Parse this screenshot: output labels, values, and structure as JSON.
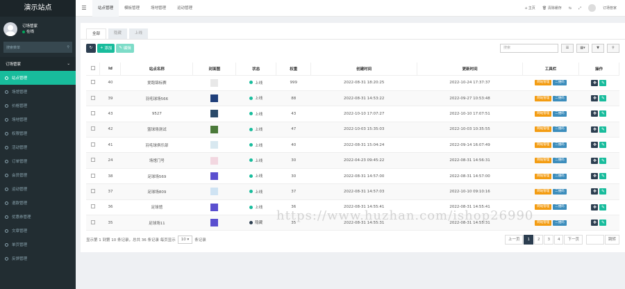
{
  "app": {
    "title": "演示站点",
    "user_name": "订场管家",
    "user_status": "在线",
    "search_placeholder": "搜索菜单"
  },
  "sidebar": {
    "group": "订场管家",
    "items": [
      {
        "label": "站点管理",
        "active": true
      },
      {
        "label": "场馆管理"
      },
      {
        "label": "价格管理"
      },
      {
        "label": "场地管理"
      },
      {
        "label": "权限管理"
      },
      {
        "label": "活动管理"
      },
      {
        "label": "订单管理"
      },
      {
        "label": "会员管理"
      },
      {
        "label": "运动管理"
      },
      {
        "label": "退款管理"
      },
      {
        "label": "优惠券管理"
      },
      {
        "label": "文章管理"
      },
      {
        "label": "单页管理"
      },
      {
        "label": "反馈管理"
      }
    ]
  },
  "topbar": {
    "tabs": [
      "站点管理",
      "模板管理",
      "场地管理",
      "运动管理"
    ],
    "home": "主页",
    "clear_cache": "清除缓存",
    "user": "订场管家"
  },
  "subtabs": [
    "全部",
    "隐藏",
    "上线"
  ],
  "toolbar": {
    "add": "添加",
    "edit": "编辑",
    "search_placeholder": "搜索"
  },
  "table": {
    "headers": [
      "Id",
      "站点名称",
      "封面图",
      "状态",
      "权重",
      "创建时间",
      "更新时间",
      "工具栏",
      "操作"
    ],
    "rows": [
      {
        "id": "40",
        "name": "爱跑锦标赛",
        "status": "上线",
        "weight": "999",
        "created": "2022-08-31 18:20:25",
        "updated": "2022-10-24 17:37:37"
      },
      {
        "id": "39",
        "name": "羽毛球场566",
        "status": "上线",
        "weight": "88",
        "created": "2022-08-31 14:53:22",
        "updated": "2022-09-27 10:53:48"
      },
      {
        "id": "43",
        "name": "9527",
        "status": "上线",
        "weight": "43",
        "created": "2022-10-10 17:07:27",
        "updated": "2022-10-10 17:07:51"
      },
      {
        "id": "42",
        "name": "篮球场测试",
        "status": "上线",
        "weight": "47",
        "created": "2022-10-03 15:35:03",
        "updated": "2022-10-03 10:35:55"
      },
      {
        "id": "41",
        "name": "羽毛球俱乐部",
        "status": "上线",
        "weight": "40",
        "created": "2022-08-31 15:04:24",
        "updated": "2022-09-14 16:07:49"
      },
      {
        "id": "24",
        "name": "场馆门号",
        "status": "上线",
        "weight": "30",
        "created": "2022-04-23 09:45:22",
        "updated": "2022-08-31 14:56:31"
      },
      {
        "id": "38",
        "name": "足球场569",
        "status": "上线",
        "weight": "30",
        "created": "2022-08-31 14:57:00",
        "updated": "2022-08-31 14:57:00"
      },
      {
        "id": "37",
        "name": "足球场809",
        "status": "上线",
        "weight": "37",
        "created": "2022-08-31 14:57:03",
        "updated": "2022-10-10 09:10:16"
      },
      {
        "id": "36",
        "name": "足球馆",
        "status": "上线",
        "weight": "36",
        "created": "2022-08-31 14:55:41",
        "updated": "2022-08-31 14:55:41"
      },
      {
        "id": "35",
        "name": "足球场11",
        "status": "隐藏",
        "weight": "35",
        "created": "2022-08-31 14:55:31",
        "updated": "2022-08-31 14:55:31"
      }
    ],
    "tool1": "网站管理",
    "tool2": "二维码"
  },
  "footer": {
    "summary": "显示第 1 到第 10 条记录，总共 36 条记录 每页显示",
    "per_page": "10",
    "suffix": "条记录",
    "pages": [
      "上一页",
      "1",
      "2",
      "3",
      "4",
      "下一页"
    ],
    "goto": "跳转"
  },
  "colors": {
    "accent": "#18bc9c",
    "sidebar": "#222d32",
    "online": "#18bc9c",
    "hidden": "#2c3e50"
  },
  "watermark": "https://www.huzhan.com/ishop26990"
}
